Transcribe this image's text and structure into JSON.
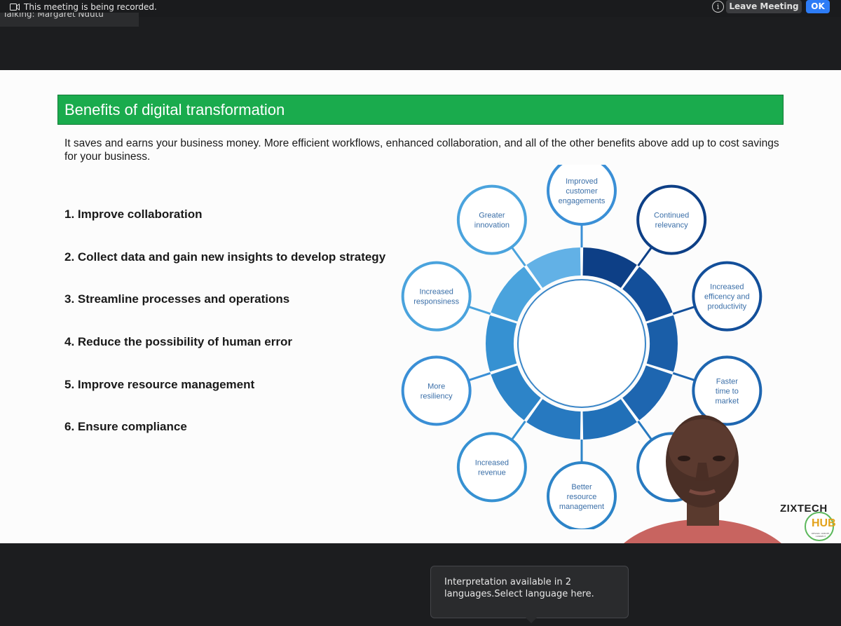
{
  "meeting_bar": {
    "recording_text": "This meeting is being recorded.",
    "talking_text": "Talking: Margaret Ndutu",
    "leave_label": "Leave Meeting",
    "ok_label": "OK",
    "icons": [
      "recording-icon",
      "info-icon"
    ]
  },
  "slide": {
    "title": "Benefits of digital transformation",
    "body": "It saves and earns your business money. More efficient workflows, enhanced collaboration, and all of the other benefits above add up to cost savings for your business.",
    "benefits": [
      "1. Improve collaboration",
      "2. Collect data and gain new insights to develop strategy",
      "3. Streamline processes and operations",
      "4. Reduce the possibility of human error",
      "5. Improve resource management",
      "6. Ensure compliance"
    ],
    "diagram_nodes": [
      [
        "Improved",
        "customer",
        "engagements"
      ],
      [
        "Continued",
        "relevancy"
      ],
      [
        "Increased",
        "efficency and",
        "productivity"
      ],
      [
        "Faster",
        "time to",
        "market"
      ],
      [],
      [
        "Better",
        "resource",
        "management"
      ],
      [
        "Increased",
        "revenue"
      ],
      [
        "More",
        "resiliency"
      ],
      [
        "Increased",
        "responsiness"
      ],
      [
        "Greater",
        "innovation"
      ]
    ],
    "colors": {
      "title_bar": "#1aab4d",
      "ring_dark": "#0d3f86",
      "ring_light": "#62b1e6",
      "node_text": "#3b6fa8"
    },
    "logo": {
      "brand": "ZIXTECH",
      "badge": "HUB",
      "tagline": "DESIGN. CREATE. CONNECT"
    }
  },
  "tooltip": {
    "text": "Interpretation available in 2 languages.Select language here."
  }
}
